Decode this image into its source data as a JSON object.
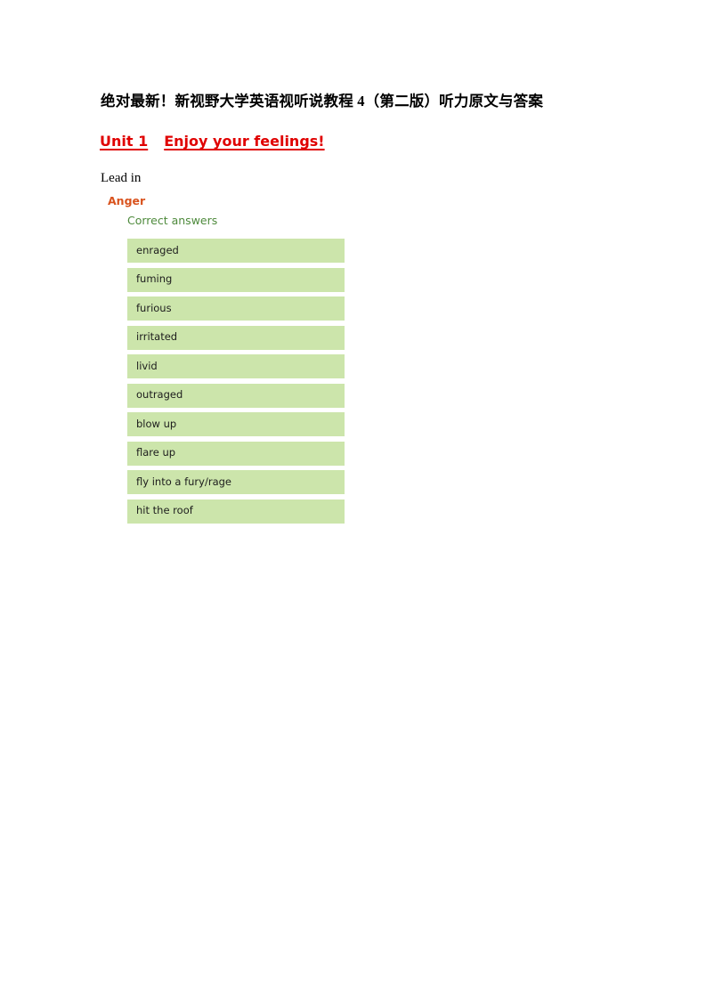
{
  "document": {
    "title": "绝对最新！新视野大学英语视听说教程 4（第二版）听力原文与答案",
    "unit": {
      "number": "Unit 1",
      "name": "Enjoy your feelings!"
    },
    "section_label": "Lead in"
  },
  "exercise": {
    "title": "Anger",
    "answers_label": "Correct answers",
    "answers": [
      {
        "text": "enraged"
      },
      {
        "text": "fuming"
      },
      {
        "text": "furious"
      },
      {
        "text": "irritated"
      },
      {
        "text": "livid"
      },
      {
        "text": "outraged"
      },
      {
        "text": "blow up"
      },
      {
        "text": "flare up"
      },
      {
        "text": "fly into a fury/rage"
      },
      {
        "text": "hit the roof"
      }
    ]
  },
  "colors": {
    "answer_box_background": "#cce5ab",
    "answer_text": "#1d1d1d",
    "exercise_title": "#d9531e",
    "answers_label": "#4e8a3c",
    "unit_heading": "#e00000",
    "document_title": "#000000",
    "page_background": "#ffffff"
  }
}
